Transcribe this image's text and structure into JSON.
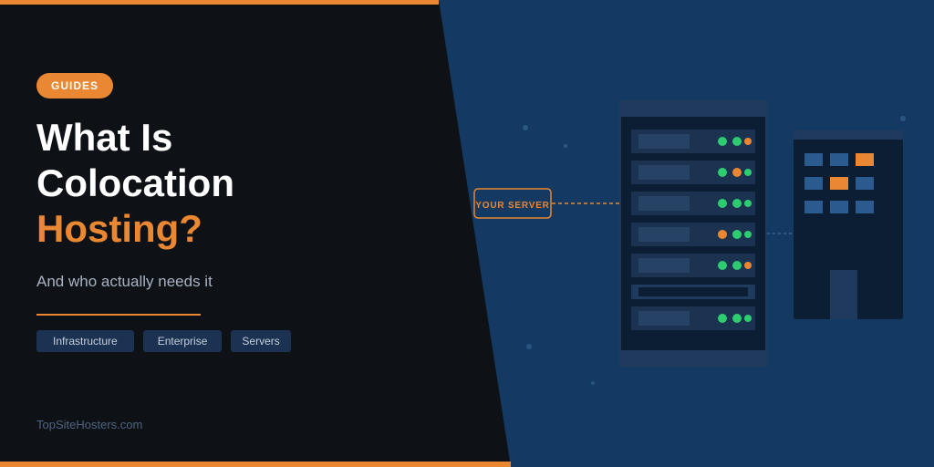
{
  "badge": {
    "label": "GUIDES"
  },
  "title": {
    "line1": "What Is",
    "line2": "Colocation",
    "line3": "Hosting?"
  },
  "subtitle": "And who actually needs it",
  "tags": [
    "Infrastructure",
    "Enterprise",
    "Servers"
  ],
  "brand": "TopSiteHosters.com",
  "illustration": {
    "server_label": "YOUR SERVER"
  },
  "colors": {
    "accent": "#e98732",
    "dark": "#0e1116",
    "navy": "#143a63",
    "led_green": "#2ecc71"
  }
}
